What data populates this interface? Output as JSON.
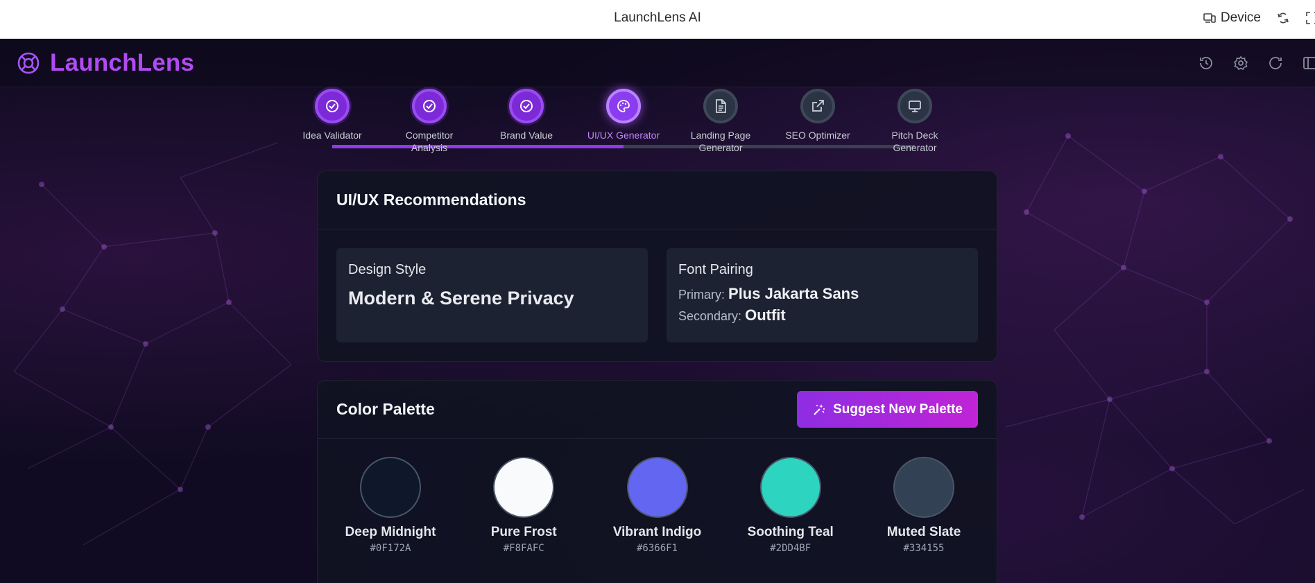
{
  "topbar": {
    "title": "LaunchLens AI",
    "device_label": "Device"
  },
  "header": {
    "brand": "LaunchLens"
  },
  "steps": [
    {
      "label": "Idea Validator",
      "status": "done"
    },
    {
      "label": "Competitor\nAnalysis",
      "status": "done"
    },
    {
      "label": "Brand Value",
      "status": "done"
    },
    {
      "label": "UI/UX Generator",
      "status": "active"
    },
    {
      "label": "Landing Page\nGenerator",
      "status": "todo"
    },
    {
      "label": "SEO Optimizer",
      "status": "todo"
    },
    {
      "label": "Pitch Deck\nGenerator",
      "status": "todo"
    }
  ],
  "recommendations": {
    "title": "UI/UX Recommendations",
    "design_style": {
      "label": "Design Style",
      "value": "Modern & Serene Privacy"
    },
    "font_pairing": {
      "label": "Font Pairing",
      "primary_label": "Primary:",
      "primary": "Plus Jakarta Sans",
      "secondary_label": "Secondary:",
      "secondary": "Outfit"
    }
  },
  "palette": {
    "title": "Color Palette",
    "suggest_label": "Suggest New Palette",
    "colors": [
      {
        "name": "Deep Midnight",
        "hex": "#0F172A"
      },
      {
        "name": "Pure Frost",
        "hex": "#F8FAFC"
      },
      {
        "name": "Vibrant Indigo",
        "hex": "#6366F1"
      },
      {
        "name": "Soothing Teal",
        "hex": "#2DD4BF"
      },
      {
        "name": "Muted Slate",
        "hex": "#334155"
      }
    ]
  },
  "colors": {
    "accent": "#a855f7",
    "brand": "#b04bf0",
    "button_from": "#8e2de2",
    "button_to": "#c024d6"
  }
}
